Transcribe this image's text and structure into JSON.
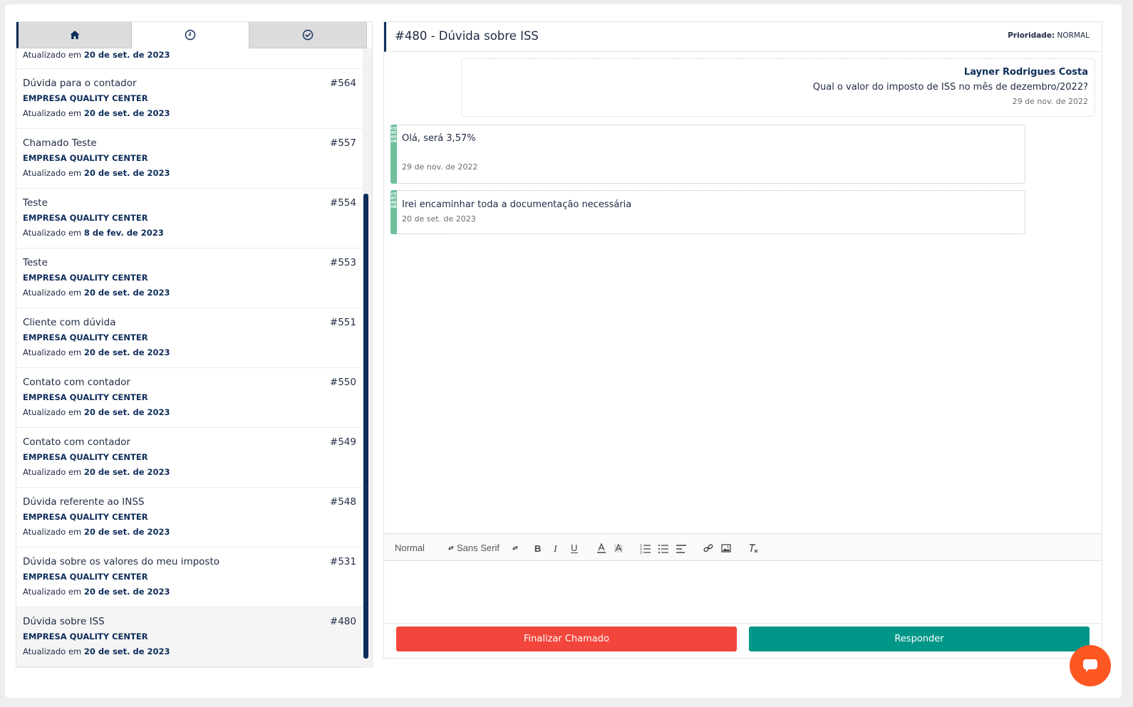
{
  "tabs": [
    {
      "icon": "home-icon",
      "active": false
    },
    {
      "icon": "clock-icon",
      "active": true
    },
    {
      "icon": "check-circle-icon",
      "active": false
    }
  ],
  "list": {
    "partial": {
      "updated_prefix": "Atualizado em",
      "updated_date": "20 de set. de 2023"
    },
    "items": [
      {
        "title": "Dúvida para o contador",
        "number": "#564",
        "company": "EMPRESA QUALITY CENTER",
        "updated_prefix": "Atualizado em",
        "updated_date": "20 de set. de 2023"
      },
      {
        "title": "Chamado Teste",
        "number": "#557",
        "company": "EMPRESA QUALITY CENTER",
        "updated_prefix": "Atualizado em",
        "updated_date": "20 de set. de 2023"
      },
      {
        "title": "Teste",
        "number": "#554",
        "company": "EMPRESA QUALITY CENTER",
        "updated_prefix": "Atualizado em",
        "updated_date": "8 de fev. de 2023"
      },
      {
        "title": "Teste",
        "number": "#553",
        "company": "EMPRESA QUALITY CENTER",
        "updated_prefix": "Atualizado em",
        "updated_date": "20 de set. de 2023"
      },
      {
        "title": "Cliente com dúvida",
        "number": "#551",
        "company": "EMPRESA QUALITY CENTER",
        "updated_prefix": "Atualizado em",
        "updated_date": "20 de set. de 2023"
      },
      {
        "title": "Contato com contador",
        "number": "#550",
        "company": "EMPRESA QUALITY CENTER",
        "updated_prefix": "Atualizado em",
        "updated_date": "20 de set. de 2023"
      },
      {
        "title": "Contato com contador",
        "number": "#549",
        "company": "EMPRESA QUALITY CENTER",
        "updated_prefix": "Atualizado em",
        "updated_date": "20 de set. de 2023"
      },
      {
        "title": "Dúvida referente ao INSS",
        "number": "#548",
        "company": "EMPRESA QUALITY CENTER",
        "updated_prefix": "Atualizado em",
        "updated_date": "20 de set. de 2023"
      },
      {
        "title": "Dúvida sobre os valores do meu imposto",
        "number": "#531",
        "company": "EMPRESA QUALITY CENTER",
        "updated_prefix": "Atualizado em",
        "updated_date": "20 de set. de 2023"
      },
      {
        "title": "Dúvida sobre ISS",
        "number": "#480",
        "company": "EMPRESA QUALITY CENTER",
        "updated_prefix": "Atualizado em",
        "updated_date": "20 de set. de 2023",
        "selected": true
      }
    ]
  },
  "ticket": {
    "title": "#480 - Dúvida sobre ISS",
    "priority_label": "Prioridade:",
    "priority_value": "NORMAL"
  },
  "messages": [
    {
      "type": "client",
      "author": "Layner Rodrigues Costa",
      "text": "Qual o valor do imposto de ISS no mês de dezembro/2022?",
      "date": "29 de nov. de 2022"
    },
    {
      "type": "accountant",
      "tag": "CONTADOR",
      "text": "Olá, será 3,57%",
      "date": "29 de nov. de 2022"
    },
    {
      "type": "accountant",
      "tag": "CONTADOR",
      "text": "Irei encaminhar toda a documentação necessária",
      "date": "20 de set. de 2023"
    }
  ],
  "editor": {
    "size_select": "Normal",
    "font_select": "Sans Serif",
    "tools": [
      "bold-icon",
      "italic-icon",
      "underline-icon",
      "text-color-icon",
      "background-color-icon",
      "ordered-list-icon",
      "bullet-list-icon",
      "align-icon",
      "link-icon",
      "image-icon",
      "clear-format-icon"
    ]
  },
  "buttons": {
    "finish_label": "Finalizar Chamado",
    "reply_label": "Responder"
  },
  "colors": {
    "navy": "#0e2d5a",
    "finish": "#f2453b",
    "reply": "#009688",
    "accountant_tag": "#6fbf9b",
    "chat_fab": "#ff5722"
  },
  "chat_fab_icon": "chat-bubble-icon"
}
